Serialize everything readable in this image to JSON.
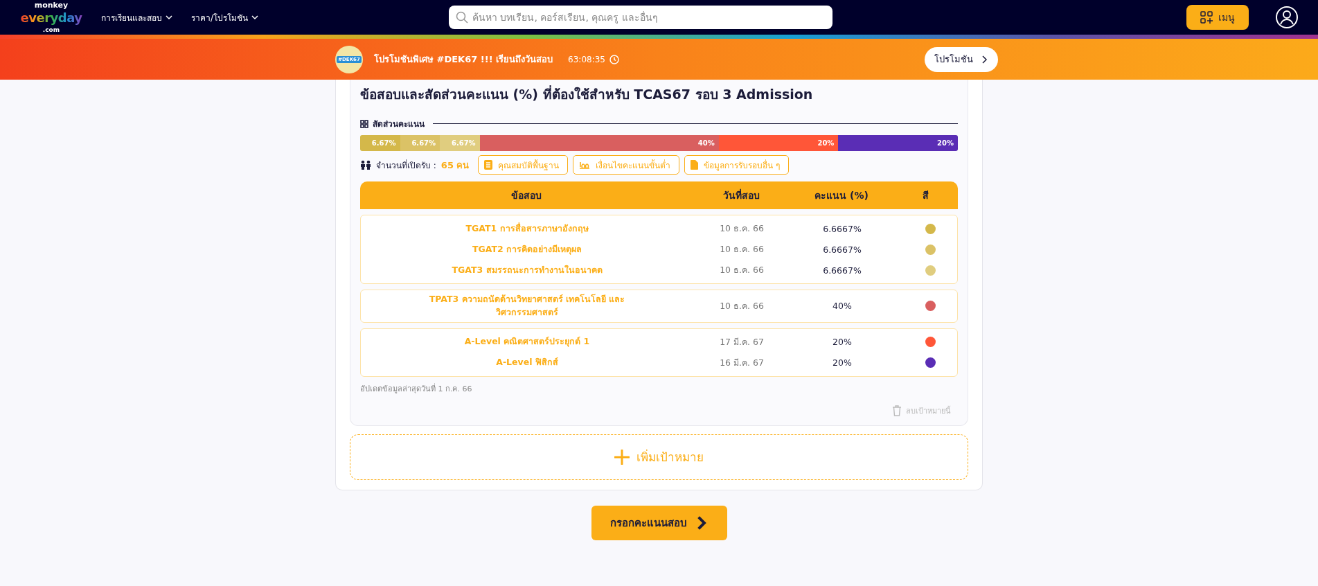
{
  "nav": {
    "logo": {
      "top": "monkey",
      "main": "everyday",
      "sub": ".com"
    },
    "menus": [
      {
        "label": "การเรียนและสอบ"
      },
      {
        "label": "ราคา/โปรโมชัน"
      }
    ],
    "search": {
      "placeholder": "ค้นหา บทเรียน, คอร์สเรียน, คุณครู และอื่นๆ"
    },
    "menu_button": "เมนู"
  },
  "promo": {
    "badge": "#DEK67",
    "text": "โปรโมชันพิเศษ #DEK67 !!! เรียนถึงวันสอบ",
    "countdown": "63:08:35",
    "button": "โปรโมชัน"
  },
  "target": {
    "title": "ข้อสอบและสัดส่วนคะแนน (%) ที่ต้องใช้สำหรับ TCAS67 รอบ 3 Admission",
    "section": "สัดส่วนคะแนน",
    "chart_data": {
      "type": "bar",
      "orientation": "horizontal",
      "stacked": true,
      "series": [
        {
          "color": "#d4b84a",
          "values": [
            6.67
          ],
          "value_labels": [
            "6.67%"
          ]
        },
        {
          "color": "#dbc266",
          "values": [
            6.67
          ],
          "value_labels": [
            "6.67%"
          ]
        },
        {
          "color": "#e0cd7f",
          "values": [
            6.67
          ],
          "value_labels": [
            "6.67%"
          ]
        },
        {
          "color": "#d95f5f",
          "values": [
            40
          ],
          "value_labels": [
            "40%"
          ]
        },
        {
          "color": "#ff5638",
          "values": [
            20
          ],
          "value_labels": [
            "20%"
          ]
        },
        {
          "color": "#5a2db5",
          "values": [
            20
          ],
          "value_labels": [
            "20%"
          ]
        }
      ]
    },
    "seats_label": "จำนวนที่เปิดรับ :",
    "seats": "65 คน",
    "info_buttons": [
      {
        "kind": "list",
        "label": "คุณสมบัติพื้นฐาน"
      },
      {
        "kind": "hundred",
        "label": "เงื่อนไขคะแนนขั้นต่ำ"
      },
      {
        "kind": "file",
        "label": "ข้อมูลการรับรอบอื่น ๆ"
      }
    ],
    "columns": [
      "ข้อสอบ",
      "วันที่สอบ",
      "คะแนน (%)",
      "สี"
    ],
    "groups": [
      [
        {
          "exam": "TGAT1 การสื่อสารภาษาอังกฤษ",
          "date": "10 ธ.ค. 66",
          "score": "6.6667%",
          "color": "#d4b84a"
        },
        {
          "exam": "TGAT2 การคิดอย่างมีเหตุผล",
          "date": "10 ธ.ค. 66",
          "score": "6.6667%",
          "color": "#dbc266"
        },
        {
          "exam": "TGAT3 สมรรถนะการทำงานในอนาคต",
          "date": "10 ธ.ค. 66",
          "score": "6.6667%",
          "color": "#e0cd7f"
        }
      ],
      [
        {
          "exam": "TPAT3 ความถนัดด้านวิทยาศาสตร์ เทคโนโลยี และวิศวกรรมศาสตร์",
          "date": "10 ธ.ค. 66",
          "score": "40%",
          "color": "#d95f5f"
        }
      ],
      [
        {
          "exam": "A-Level คณิตศาสตร์ประยุกต์ 1",
          "date": "17 มี.ค. 67",
          "score": "20%",
          "color": "#ff5638"
        },
        {
          "exam": "A-Level ฟิสิกส์",
          "date": "16 มี.ค. 67",
          "score": "20%",
          "color": "#5a2db5"
        }
      ]
    ],
    "updated": "อัปเดตข้อมูลล่าสุดวันที่ 1 ก.ค. 66",
    "delete_button": "ลบเป้าหมายนี้"
  },
  "add_target": "เพิ่มเป้าหมาย",
  "submit": "กรอกคะแนนสอบ"
}
